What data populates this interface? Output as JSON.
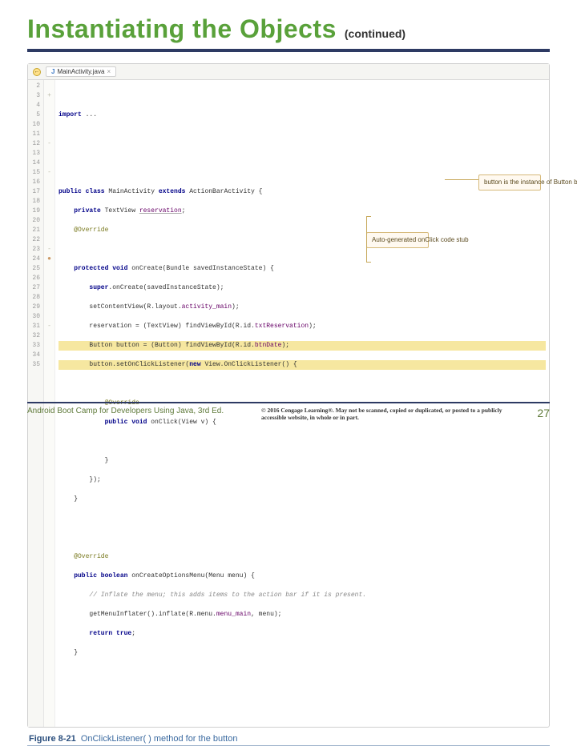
{
  "header": {
    "title": "Instantiating the Objects",
    "subtitle": "(continued)"
  },
  "ide": {
    "tab_filename": "MainActivity.java",
    "gutter": [
      "2",
      "3",
      "4",
      "5",
      "10",
      "11",
      "12",
      "13",
      "14",
      "15",
      "16",
      "17",
      "18",
      "19",
      "20",
      "21",
      "22",
      "23",
      "24",
      "25",
      "26",
      "27",
      "28",
      "29",
      "30",
      "31",
      "32",
      "33",
      "34",
      "35"
    ],
    "fold_marks": {
      "3": "+",
      "12": "-",
      "15": "-",
      "23": "-",
      "31": "-"
    },
    "breakpoint_rows": [
      "23",
      "24"
    ],
    "code": {
      "l2": "",
      "l3": "import ...",
      "l4": "",
      "l5": "",
      "l10": "",
      "l11": "public class MainActivity extends ActionBarActivity {",
      "l12": "    private TextView reservation;",
      "l13": "    @Override",
      "l14": "",
      "l15": "    protected void onCreate(Bundle savedInstanceState) {",
      "l16": "        super.onCreate(savedInstanceState);",
      "l17": "        setContentView(R.layout.activity_main);",
      "l18": "        reservation = (TextView) findViewById(R.id.txtReservation);",
      "l19": "        Button button = (Button) findViewById(R.id.btnDate);",
      "l20": "        button.setOnClickListener(new View.OnClickListener() {",
      "l21": "",
      "l22": "            @Override",
      "l23": "            public void onClick(View v) {",
      "l24": "",
      "l25": "            }",
      "l26": "        });",
      "l27": "    }",
      "l28": "",
      "l29": "",
      "l30": "    @Override",
      "l31": "    public boolean onCreateOptionsMenu(Menu menu) {",
      "l32": "        // Inflate the menu; this adds items to the action bar if it is present.",
      "l33": "        getMenuInflater().inflate(R.menu.menu_main, menu);",
      "l34": "        return true;",
      "l35": "    }"
    },
    "callout_right": "button is the instance of Button btnDate",
    "callout_mid": "Auto-generated onClick code stub"
  },
  "figure": {
    "label": "Figure 8-21",
    "caption": "OnClickListener( ) method for the button"
  },
  "footer": {
    "book": "Android Boot Camp for Developers Using Java, 3rd Ed.",
    "copyright": "© 2016 Cengage Learning®. May not be scanned, copied or duplicated, or posted to a publicly accessible website, in whole or in part.",
    "page": "27"
  }
}
